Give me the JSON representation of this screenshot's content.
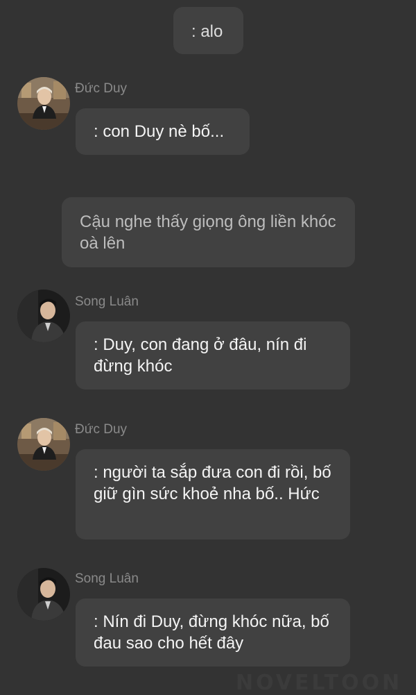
{
  "opening": {
    "text": ": alo"
  },
  "narration": {
    "text": "Cậu nghe thấy giọng ông liền khóc oà lên"
  },
  "messages": [
    {
      "sender": "Đức Duy",
      "avatar_icon": "avatar-duc-duy-icon",
      "text": ": con Duy nè bố..."
    },
    {
      "sender": "Song Luân",
      "avatar_icon": "avatar-song-luan-icon",
      "text": ": Duy, con đang ở đâu, nín đi đừng khóc"
    },
    {
      "sender": "Đức Duy",
      "avatar_icon": "avatar-duc-duy-icon",
      "text": ": người ta sắp đưa con đi rồi, bố giữ gìn sức khoẻ nha bố.. Hức"
    },
    {
      "sender": "Song Luân",
      "avatar_icon": "avatar-song-luan-icon",
      "text": ": Nín đi Duy, đừng khóc nữa, bố đau sao cho hết đây"
    }
  ],
  "watermark": {
    "text": "NOVELTOON"
  },
  "colors": {
    "background": "#333333",
    "bubble": "#414141",
    "sender_name": "#8a8a8a",
    "narration_text": "#bdbdbd"
  }
}
